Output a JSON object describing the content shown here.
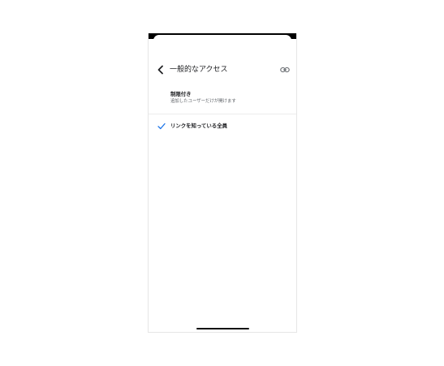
{
  "header": {
    "title": "一般的なアクセス",
    "back_icon": "chevron-left-icon",
    "link_icon": "link-icon"
  },
  "options": [
    {
      "title": "制限付き",
      "subtitle": "追加したユーザーだけが開けます",
      "selected": false
    },
    {
      "title": "リンクを知っている全員",
      "selected": true,
      "icon": "checkmark-icon"
    }
  ],
  "colors": {
    "accent": "#1a73e8",
    "text_primary": "#202124",
    "text_secondary": "#5f6368",
    "status_bar": "#000000"
  }
}
